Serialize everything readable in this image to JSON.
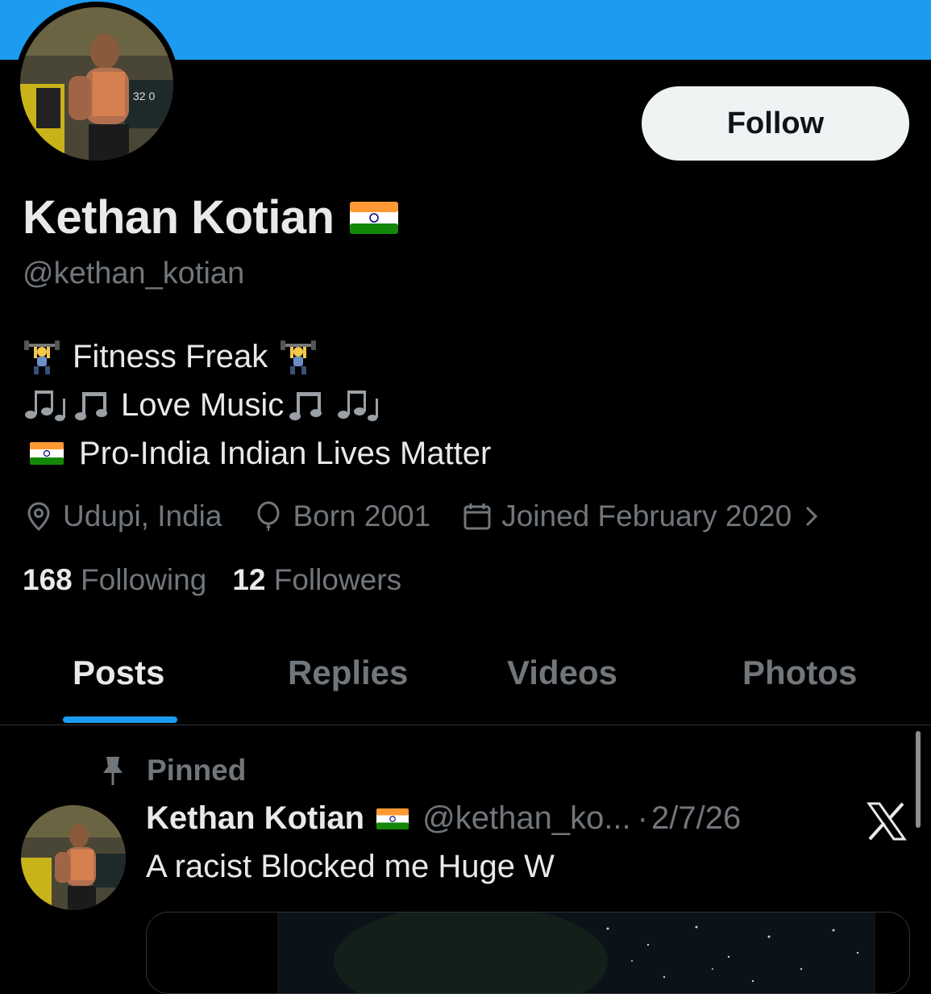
{
  "header": {
    "banner_color": "#1d9bf0"
  },
  "profile": {
    "display_name": "Kethan Kotian",
    "handle": "@kethan_kotian",
    "follow_label": "Follow",
    "bio": {
      "line1_text": "Fitness Freak",
      "line2_text": "Love Music",
      "line3_text": "Pro-India Indian Lives Matter"
    },
    "meta": {
      "location": "Udupi, India",
      "born": "Born 2001",
      "joined": "Joined February 2020"
    },
    "stats": {
      "following_count": "168",
      "following_label": "Following",
      "followers_count": "12",
      "followers_label": "Followers"
    }
  },
  "tabs": [
    {
      "label": "Posts",
      "active": true
    },
    {
      "label": "Replies",
      "active": false
    },
    {
      "label": "Videos",
      "active": false
    },
    {
      "label": "Photos",
      "active": false
    }
  ],
  "post": {
    "pinned_label": "Pinned",
    "author_name": "Kethan Kotian",
    "author_handle": "@kethan_ko...",
    "separator": "·",
    "date": "2/7/26",
    "text": "A racist Blocked me Huge W"
  },
  "icons": {
    "location": "location-pin-icon",
    "born": "balloon-icon",
    "joined": "calendar-icon",
    "pin": "pin-icon",
    "x": "x-logo-icon"
  }
}
